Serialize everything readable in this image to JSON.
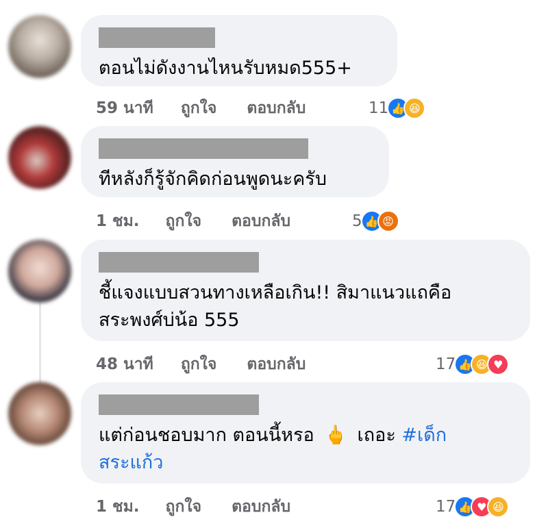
{
  "comments": [
    {
      "text_lines": [
        "ตอนไม่ดังงานไหนรับหมด555+"
      ],
      "time": "59 นาที",
      "like_label": "ถูกใจ",
      "reply_label": "ตอบกลับ",
      "reaction_count": "11",
      "reactions": [
        "like",
        "haha"
      ]
    },
    {
      "text_lines": [
        "ทีหลังก็รู้จักคิดก่อนพูดนะครับ"
      ],
      "time": "1 ชม.",
      "like_label": "ถูกใจ",
      "reply_label": "ตอบกลับ",
      "reaction_count": "5",
      "reactions": [
        "like",
        "angry"
      ]
    },
    {
      "text_lines": [
        "ชี้แจงแบบสวนทางเหลือเกิน!! สิมาแนวแถคือ",
        "สระพงศ์บ่น้อ 555"
      ],
      "time": "48 นาที",
      "like_label": "ถูกใจ",
      "reply_label": "ตอบกลับ",
      "reaction_count": "17",
      "reactions": [
        "like",
        "haha",
        "love"
      ]
    },
    {
      "text_line1": "แต่ก่อนชอบมาก ตอนนี้หรอ",
      "emoji": "🖕",
      "text_line1_tail": "เถอะ",
      "hashtag_part1": "#เด็ก",
      "hashtag_part2": "สระแก้ว",
      "time": "1 ชม.",
      "like_label": "ถูกใจ",
      "reply_label": "ตอบกลับ",
      "reaction_count": "17",
      "reactions": [
        "like",
        "love",
        "haha"
      ]
    }
  ],
  "colors": {
    "bubble": "#f0f2f5",
    "meta_text": "#65676b",
    "hashtag": "#216fdb",
    "like": "#1877f2",
    "haha": "#f7b125",
    "angry": "#e9710f",
    "love": "#f33e58"
  }
}
